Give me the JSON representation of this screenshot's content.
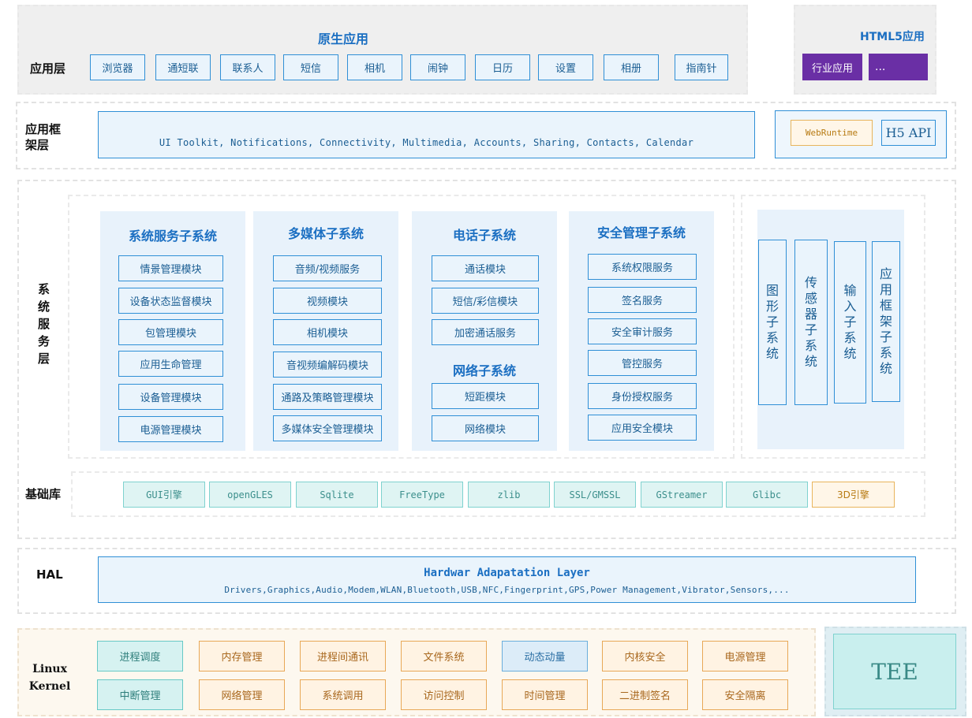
{
  "app_layer": {
    "label": "应用层",
    "native_title": "原生应用",
    "apps": [
      "浏览器",
      "通短联",
      "联系人",
      "短信",
      "相机",
      "闹钟",
      "日历",
      "设置",
      "相册",
      "指南针"
    ],
    "html5_title": "HTML5应用",
    "html5_apps": [
      "行业应用",
      "..."
    ]
  },
  "framework_layer": {
    "label_line1": "应用框",
    "label_line2": "架层",
    "toolkit_text": "UI Toolkit, Notifications, Connectivity, Multimedia, Accounts, Sharing, Contacts, Calendar",
    "webruntime": "WebRuntime",
    "h5api": "H5 API"
  },
  "service_layer": {
    "label_chars": [
      "系",
      "统",
      "服",
      "务",
      "层"
    ],
    "system_service": {
      "title": "系统服务子系统",
      "items": [
        "情景管理模块",
        "设备状态监督模块",
        "包管理模块",
        "应用生命管理",
        "设备管理模块",
        "电源管理模块"
      ]
    },
    "multimedia": {
      "title": "多媒体子系统",
      "items": [
        "音频/视频服务",
        "视频模块",
        "相机模块",
        "音视频编解码模块",
        "通路及策略管理模块",
        "多媒体安全管理模块"
      ]
    },
    "telephony": {
      "title": "电话子系统",
      "items": [
        "通话模块",
        "短信/彩信模块",
        "加密通话服务"
      ]
    },
    "network": {
      "title": "网络子系统",
      "items": [
        "短距模块",
        "网络模块"
      ]
    },
    "security": {
      "title": "安全管理子系统",
      "items": [
        "系统权限服务",
        "签名服务",
        "安全审计服务",
        "管控服务",
        "身份授权服务",
        "应用安全模块"
      ]
    },
    "vertical": [
      [
        "图",
        "形",
        "子",
        "系",
        "统"
      ],
      [
        "传",
        "感",
        "器",
        "子",
        "系",
        "统"
      ],
      [
        "输",
        "入",
        "子",
        "系",
        "统"
      ],
      [
        "应",
        "用",
        "框",
        "架",
        "子",
        "系",
        "统"
      ]
    ]
  },
  "base_lib": {
    "label": "基础库",
    "libs": [
      "GUI引擎",
      "openGLES",
      "Sqlite",
      "FreeType",
      "zlib",
      "SSL/GMSSL",
      "GStreamer",
      "Glibc",
      "3D引擎"
    ]
  },
  "hal": {
    "label": "HAL",
    "title": "Hardwar Adapatation Layer",
    "subtitle": "Drivers,Graphics,Audio,Modem,WLAN,Bluetooth,USB,NFC,Fingerprint,GPS,Power Management,Vibrator,Sensors,..."
  },
  "kernel": {
    "label_line1": "Linux",
    "label_line2": "Kernel",
    "row1": [
      "进程调度",
      "内存管理",
      "进程间通讯",
      "文件系统",
      "动态动量",
      "内核安全",
      "电源管理"
    ],
    "row2": [
      "中断管理",
      "网络管理",
      "系统调用",
      "访问控制",
      "时间管理",
      "二进制签名",
      "安全隔离"
    ],
    "tee": "TEE"
  },
  "colors": {
    "primary_blue": "#1b6fc2",
    "purple": "#6a2fa5",
    "teal": "#67c9c6",
    "orange": "#e8a857"
  }
}
